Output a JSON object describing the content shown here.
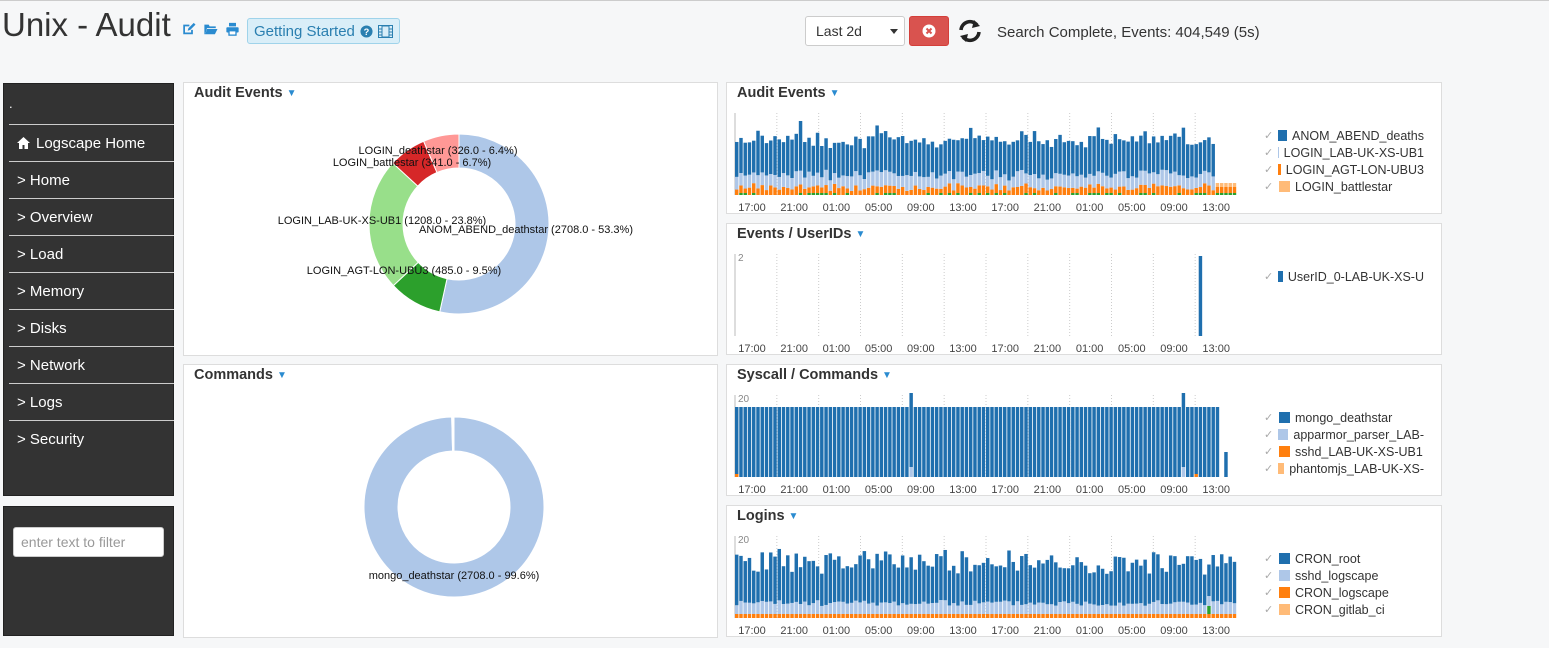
{
  "header": {
    "title": "Unix - Audit",
    "getting_started": "Getting Started",
    "time_range": "Last 2d",
    "status": "Search Complete, Events: 404,549 (5s)"
  },
  "sidebar": {
    "dot": ".",
    "items": [
      {
        "label": "Logscape Home"
      },
      {
        "label": "> Home"
      },
      {
        "label": "> Overview"
      },
      {
        "label": "> Load"
      },
      {
        "label": "> Memory"
      },
      {
        "label": "> Disks"
      },
      {
        "label": "> Network"
      },
      {
        "label": "> Logs"
      },
      {
        "label": "> Security"
      }
    ],
    "filter_placeholder": "enter text to filter"
  },
  "colors": {
    "dark_blue": "#1f6fae",
    "light_blue": "#aec7e8",
    "orange": "#ff7f0e",
    "light_orange": "#ffbb78",
    "green": "#2ca02c",
    "light_green": "#98df8a",
    "red": "#d62728",
    "pink": "#ff9896"
  },
  "x_ticks": [
    "17:00",
    "21:00",
    "01:00",
    "05:00",
    "09:00",
    "13:00",
    "17:00",
    "21:00",
    "01:00",
    "05:00",
    "09:00",
    "13:00"
  ],
  "chart_data": [
    {
      "id": "audit_pie",
      "title": "Audit Events",
      "type": "pie",
      "slices": [
        {
          "label": "ANOM_ABEND_deathstar (2708.0 - 53.3%)",
          "value": 2708,
          "color": "#aec7e8"
        },
        {
          "label": "LOGIN_AGT-LON-UBU3 (485.0 - 9.5%)",
          "value": 485,
          "color": "#2ca02c"
        },
        {
          "label": "LOGIN_LAB-UK-XS-UB1 (1208.0 - 23.8%)",
          "value": 1208,
          "color": "#98df8a"
        },
        {
          "label": "LOGIN_battlestar (341.0 - 6.7%)",
          "value": 341,
          "color": "#d62728"
        },
        {
          "label": "LOGIN_deathstar (326.0 - 6.4%)",
          "value": 326,
          "color": "#ff9896"
        }
      ]
    },
    {
      "id": "commands_pie",
      "title": "Commands",
      "type": "pie",
      "slices": [
        {
          "label": "mongo_deathstar (2708.0 - 99.6%)",
          "value": 2708,
          "color": "#aec7e8"
        },
        {
          "label": "",
          "value": 11,
          "color": "#ffffff"
        }
      ]
    },
    {
      "id": "audit_bar",
      "title": "Audit Events",
      "type": "bar",
      "legend": [
        "ANOM_ABEND_deaths",
        "LOGIN_LAB-UK-XS-UB1",
        "LOGIN_AGT-LON-UBU3",
        "LOGIN_battlestar"
      ],
      "legend_colors": [
        "#1f6fae",
        "#aec7e8",
        "#ff7f0e",
        "#ffbb78"
      ]
    },
    {
      "id": "userids_bar",
      "title": "Events / UserIDs",
      "type": "bar",
      "y_ticks": [
        "2"
      ],
      "legend": [
        "UserID_0-LAB-UK-XS-U"
      ],
      "legend_colors": [
        "#1f6fae"
      ]
    },
    {
      "id": "syscall_bar",
      "title": "Syscall / Commands",
      "type": "bar",
      "y_ticks": [
        "20"
      ],
      "legend": [
        "mongo_deathstar",
        "apparmor_parser_LAB-",
        "sshd_LAB-UK-XS-UB1",
        "phantomjs_LAB-UK-XS-"
      ],
      "legend_colors": [
        "#1f6fae",
        "#aec7e8",
        "#ff7f0e",
        "#ffbb78"
      ]
    },
    {
      "id": "logins_bar",
      "title": "Logins",
      "type": "bar",
      "y_ticks": [
        "20"
      ],
      "legend": [
        "CRON_root",
        "sshd_logscape",
        "CRON_logscape",
        "CRON_gitlab_ci"
      ],
      "legend_colors": [
        "#1f6fae",
        "#aec7e8",
        "#ff7f0e",
        "#ffbb78"
      ]
    }
  ]
}
